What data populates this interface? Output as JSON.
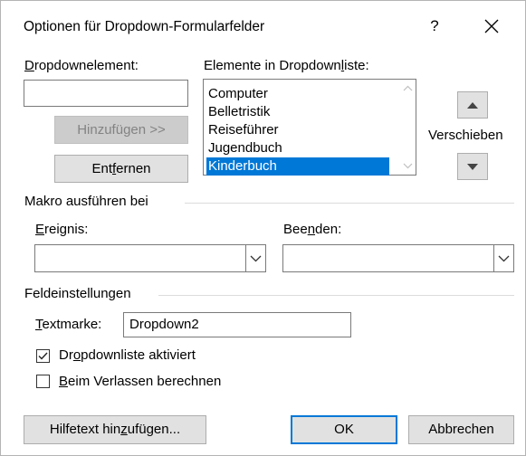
{
  "dialog": {
    "title": "Optionen für Dropdown-Formularfelder",
    "help_glyph": "?",
    "close_glyph": "✕"
  },
  "dropdown_element": {
    "label_mnemonic": "D",
    "label_rest": "ropdownelement:",
    "value": ""
  },
  "list": {
    "label_pre": "Elemente in Dropdown",
    "label_mnemonic": "l",
    "label_post": "iste:",
    "items": [
      "Computer",
      "Belletristik",
      "Reiseführer",
      "Jugendbuch",
      "Kinderbuch"
    ],
    "selected_index": 4
  },
  "buttons": {
    "add": "Hinzufügen >>",
    "remove_pre": "Ent",
    "remove_mnemonic": "f",
    "remove_post": "ernen",
    "move_label": "Verschieben",
    "help_text_pre": "Hilfetext hin",
    "help_text_mnemonic": "z",
    "help_text_post": "ufügen...",
    "ok": "OK",
    "cancel": "Abbrechen"
  },
  "macro": {
    "group_label": "Makro ausführen bei",
    "event_mnemonic": "E",
    "event_rest": "reignis:",
    "event_value": "",
    "exit_pre": "Bee",
    "exit_mnemonic": "n",
    "exit_post": "den:",
    "exit_value": ""
  },
  "field_settings": {
    "group_label": "Feldeinstellungen",
    "bookmark_mnemonic": "T",
    "bookmark_rest": "extmarke:",
    "bookmark_value": "Dropdown2",
    "enabled_pre": "Dr",
    "enabled_mnemonic": "o",
    "enabled_post": "pdownliste aktiviert",
    "enabled_checked": true,
    "calc_mnemonic": "B",
    "calc_rest": "eim Verlassen berechnen",
    "calc_checked": false
  }
}
